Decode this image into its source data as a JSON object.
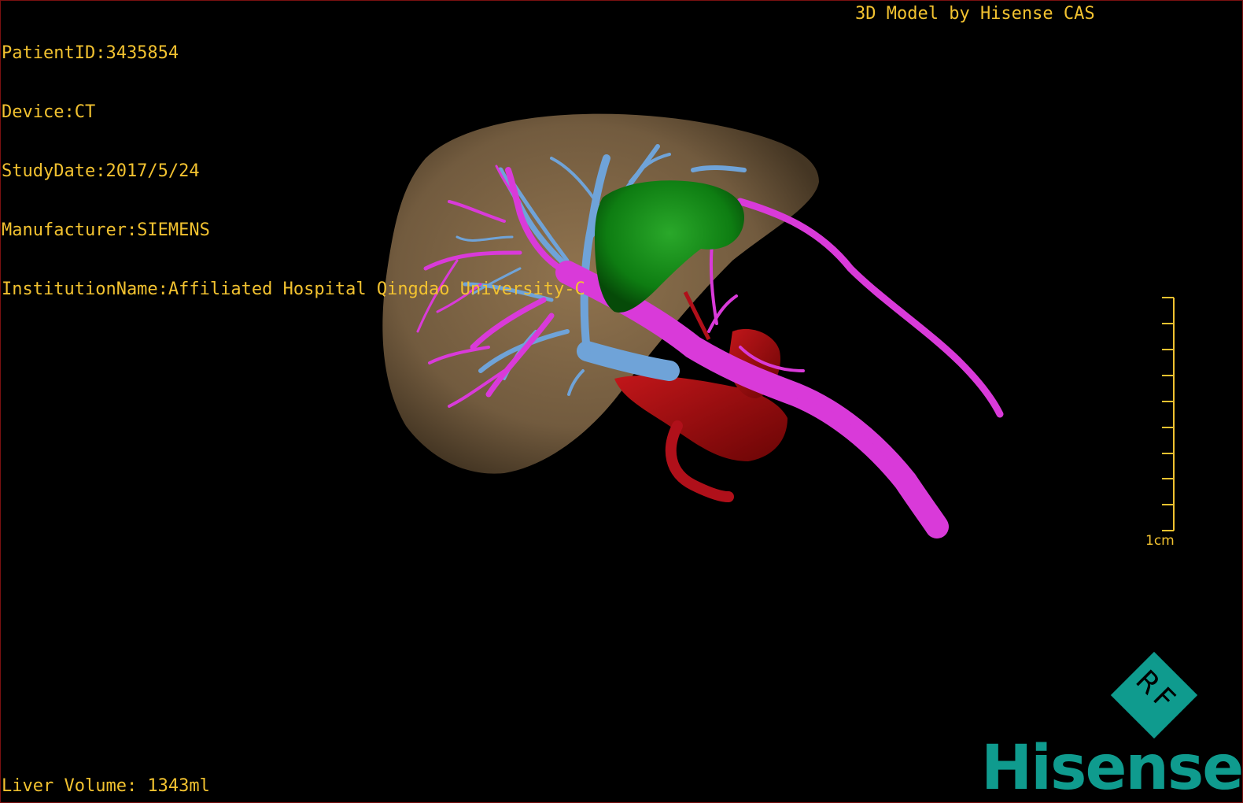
{
  "overlay": {
    "patient_id": "PatientID:3435854",
    "device": "Device:CT",
    "study_date": "StudyDate:2017/5/24",
    "manufacturer": "Manufacturer:SIEMENS",
    "institution": "InstitutionName:Affiliated Hospital Qingdao University-C",
    "model_credit": "3D Model by Hisense CAS",
    "liver_volume": "Liver Volume: 1343ml"
  },
  "scale_bar": {
    "label": "1cm",
    "ticks": 10
  },
  "brand": {
    "wordmark": "Hisense",
    "badge": "RF",
    "color": "#0f9b8e"
  },
  "structures": {
    "liver": "#8a6f4c",
    "tumor": "#0e7d12",
    "portal_vein": "#d93ad9",
    "hepatic_vein": "#6fa3d8",
    "artery": "#9e0b0b"
  },
  "colors": {
    "background": "#000000",
    "text": "#f2c230"
  }
}
